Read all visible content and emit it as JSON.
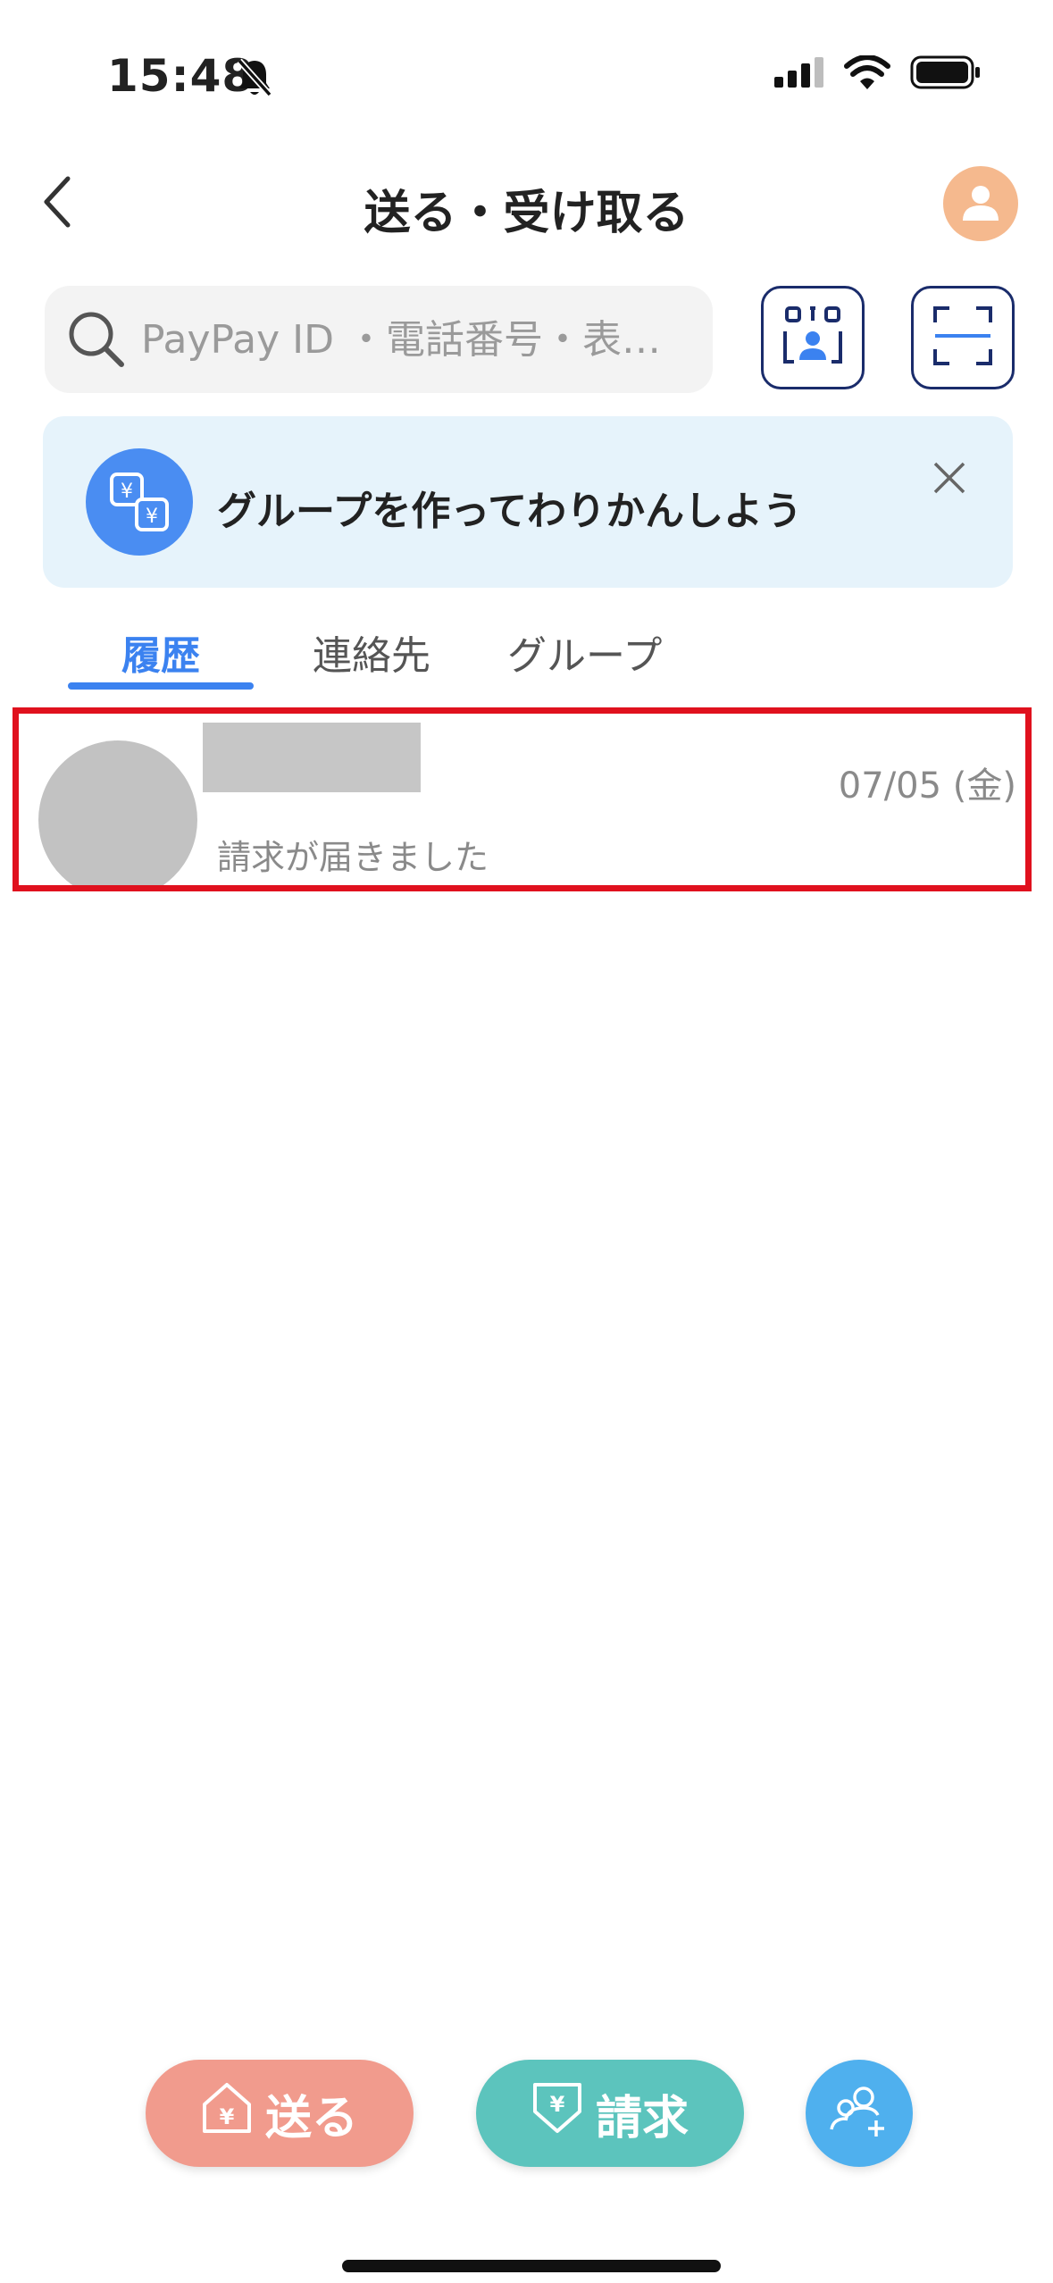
{
  "status_bar": {
    "time": "15:48",
    "icons": [
      "bell-slash-icon",
      "cellular-signal-icon",
      "wifi-icon",
      "battery-icon"
    ]
  },
  "header": {
    "title": "送る・受け取る",
    "back_icon": "chevron-left-icon",
    "avatar_icon": "user-avatar-icon"
  },
  "search": {
    "placeholder": "PayPay ID ・電話番号・表…",
    "icon": "search-icon"
  },
  "toolbar_buttons": [
    {
      "icon": "my-qr-code-icon"
    },
    {
      "icon": "scan-icon"
    }
  ],
  "banner": {
    "text": "グループを作ってわりかんしよう",
    "icon": "group-yen-exchange-icon",
    "close_icon": "close-icon"
  },
  "tabs": [
    {
      "label": "履歴",
      "active": true
    },
    {
      "label": "連絡先",
      "active": false
    },
    {
      "label": "グループ",
      "active": false
    }
  ],
  "history": [
    {
      "name": "",
      "date": "07/05 (金)",
      "message": "請求が届きました"
    }
  ],
  "actions": {
    "send_label": "送る",
    "request_label": "請求",
    "add_icon": "add-friend-icon"
  },
  "colors": {
    "accent": "#3b82f0",
    "send": "#f19b8d",
    "request": "#5cc4bd",
    "add": "#4fb0ee",
    "banner_bg": "#e6f3fb",
    "highlight": "#e0111e"
  }
}
